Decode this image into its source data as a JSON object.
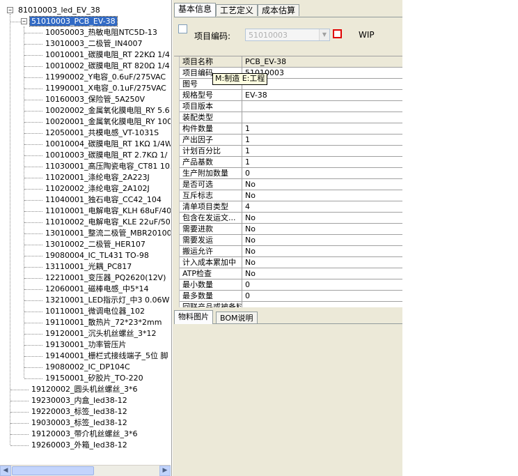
{
  "tree": {
    "root": {
      "label": "81010003_led_EV_38",
      "expander": "−"
    },
    "selected": {
      "label": "51010003_PCB_EV-38",
      "expander": "−"
    },
    "children": [
      "10050003_热敏电阻NTC5D-13",
      "13010003_二极管_IN4007",
      "10010001_碳膜电阻_RT  22KΩ  1/4",
      "10010002_碳膜电阻_RT  820Ω  1/4",
      "11990002_Y电容_0.6uF/275VAC",
      "11990001_X电容_0.1uF/275VAC",
      "10160003_保险管_5A250V",
      "10020002_金属氧化膜电阻_RY  5.6",
      "10020001_金属氧化膜电阻_RY  100",
      "12050001_共模电感_VT-1031S",
      "10010004_碳膜电阻_RT  1KΩ  1/4W",
      "10010003_碳膜电阻_RT  2.7KΩ  1/",
      "11030001_高压陶瓷电容_CT81  103",
      "11020001_涤纶电容_2A223J",
      "11020002_涤纶电容_2A102J",
      "11040001_独石电容_CC42_104",
      "11010001_电解电容_KLH  68uF/400",
      "11010002_电解电容_KLE  22uF/50V",
      "13010001_整流二极管_MBR20100C",
      "13010002_二极管_HER107",
      "19080004_IC_TL431  TO-98",
      "13110001_光耦_PC817",
      "12210001_变压器_PQ2620(12V)",
      "12060001_磁棒电感_中5*14",
      "13210001_LED指示灯_中3  0.06W",
      "10110001_微调电位器_102",
      "19110001_散热片_72*23*2mm",
      "19120001_沉头机丝螺丝_3*12",
      "19130001_功率管压片",
      "19140001_栅栏式接线端子_5位  脚",
      "19080002_IC_DP104C",
      "19150001_矽胶片_TO-220"
    ],
    "siblings": [
      "19120002_圆头机丝螺丝_3*6",
      "19230003_内盒_led38-12",
      "19220003_标签_led38-12",
      "19030003_标签_led38-12",
      "19120003_带介机丝螺丝_3*6",
      "19260003_外箱_led38-12"
    ],
    "scroll_left": "◀",
    "scroll_right": "▶"
  },
  "tabs": [
    {
      "label": "基本信息",
      "active": true
    },
    {
      "label": "工艺定义",
      "active": false
    },
    {
      "label": "成本估算",
      "active": false
    }
  ],
  "form": {
    "item_code_label": "项目编码:",
    "item_code_value": "51010003",
    "combo_arrow": "▼",
    "wip_label": "WIP",
    "accent_border": "#e00000"
  },
  "grid": [
    {
      "key": "项目名称",
      "value": "PCB_EV-38"
    },
    {
      "key": "项目编码",
      "value": "51010003"
    },
    {
      "key": "图号",
      "value": ""
    },
    {
      "key": "规格型号",
      "value": "EV-38"
    },
    {
      "key": "项目版本",
      "value": ""
    },
    {
      "key": "装配类型",
      "value": ""
    },
    {
      "key": "构件数量",
      "value": "1"
    },
    {
      "key": "产出因子",
      "value": "1"
    },
    {
      "key": "计划百分比",
      "value": "1"
    },
    {
      "key": "产品基数",
      "value": "1"
    },
    {
      "key": "生产附加数量",
      "value": "0"
    },
    {
      "key": "是否可选",
      "value": "No"
    },
    {
      "key": "互斥标志",
      "value": "No"
    },
    {
      "key": "清单项目类型",
      "value": "4"
    },
    {
      "key": "包含在发运文...",
      "value": "No"
    },
    {
      "key": "需要进款",
      "value": "No"
    },
    {
      "key": "需要发运",
      "value": "No"
    },
    {
      "key": "搬运允许",
      "value": "No"
    },
    {
      "key": "计入成本累加中",
      "value": "No"
    },
    {
      "key": "ATP检查",
      "value": "No"
    },
    {
      "key": "最小数量",
      "value": "0"
    },
    {
      "key": "最多数量",
      "value": "0"
    },
    {
      "key": "回联产品或被备料",
      "value": ""
    }
  ],
  "tooltip": "M:制造 E:工程",
  "bottom_tabs": [
    {
      "label": "物料图片",
      "active": true
    },
    {
      "label": "BOM说明",
      "active": false
    }
  ]
}
